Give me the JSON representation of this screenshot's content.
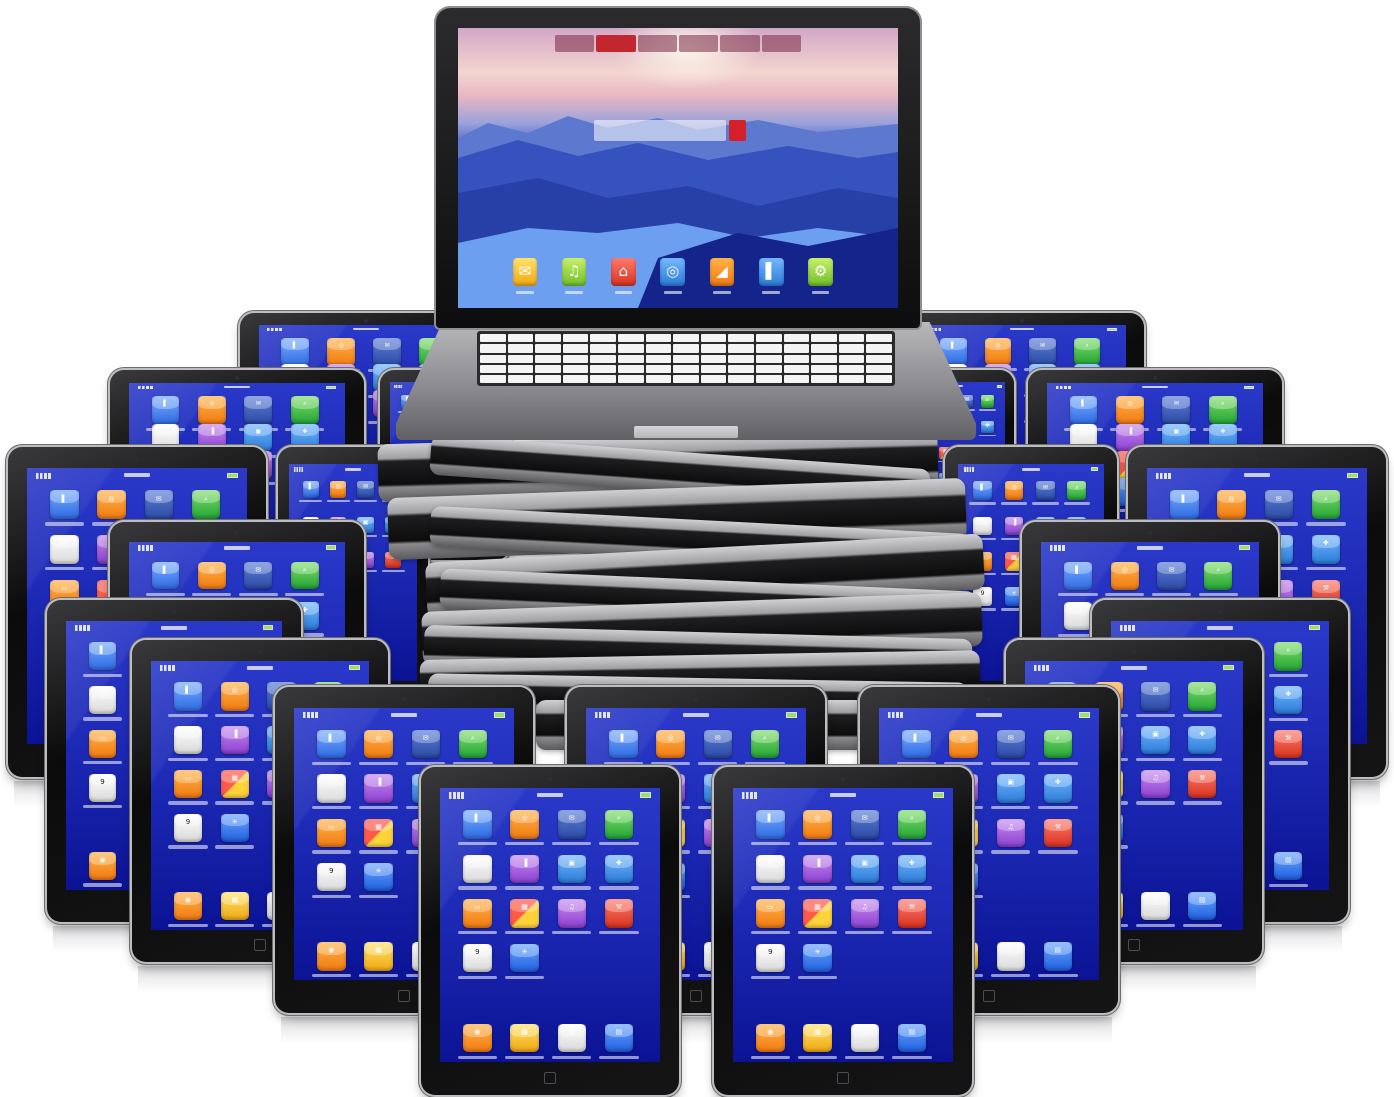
{
  "calendar_day": "9"
}
